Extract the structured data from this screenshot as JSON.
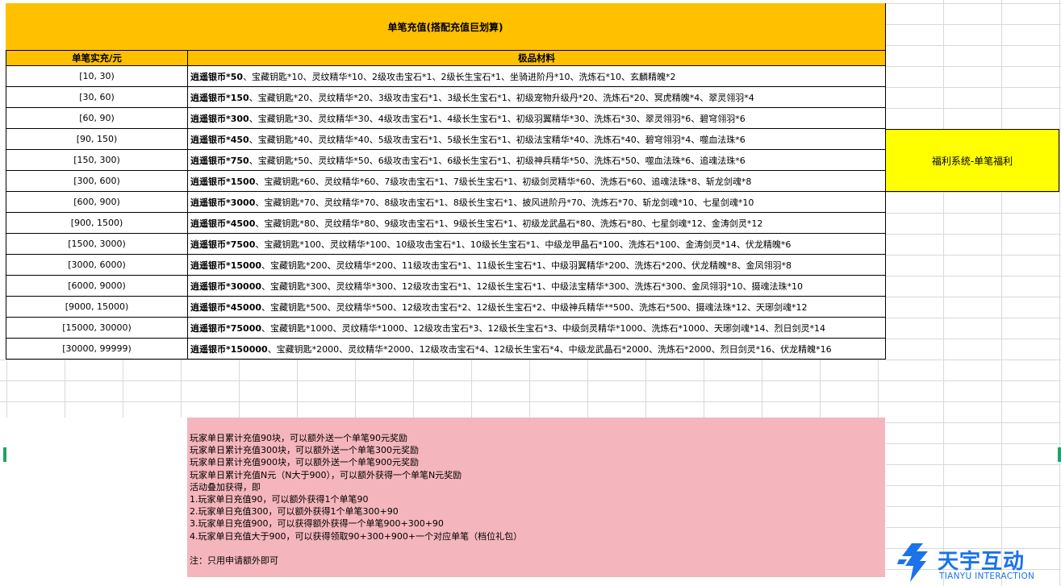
{
  "sheet": {
    "title": "单笔充值(搭配充值巨划算)",
    "headers": {
      "range": "单笔实充/元",
      "materials": "极品材料"
    },
    "rows": [
      {
        "range": "[10, 30)",
        "silver": "逍遥银币*50",
        "rest": "、宝藏钥匙*10、灵纹精华*10、2级攻击宝石*1、2级长生宝石*1、坐骑进阶丹*10、洗炼石*10、玄麟精魄*2"
      },
      {
        "range": "[30, 60)",
        "silver": "逍遥银币*150",
        "rest": "、宝藏钥匙*20、灵纹精华*20、3级攻击宝石*1、3级长生宝石*1、初级宠物升级丹*20、洗炼石*20、冥虎精魄*4、翠灵翎羽*4"
      },
      {
        "range": "[60, 90)",
        "silver": "逍遥银币*300",
        "rest": "、宝藏钥匙*30、灵纹精华*30、4级攻击宝石*1、4级长生宝石*1、初级羽翼精华*30、洗炼石*30、翠灵翎羽*6、碧穹翎羽*6"
      },
      {
        "range": "[90, 150)",
        "silver": "逍遥银币*450",
        "rest": "、宝藏钥匙*40、灵纹精华*40、5级攻击宝石*1、5级长生宝石*1、初级法宝精华*40、洗炼石*40、碧穹翎羽*4、噬血法珠*6"
      },
      {
        "range": "[150, 300)",
        "silver": "逍遥银币*750",
        "rest": "、宝藏钥匙*50、灵纹精华*50、6级攻击宝石*1、6级长生宝石*1、初级神兵精华*50、洗炼石*50、噬血法珠*6、追魂法珠*6"
      },
      {
        "range": "[300, 600)",
        "silver": "逍遥银币*1500",
        "rest": "、宝藏钥匙*60、灵纹精华*60、7级攻击宝石*1、7级长生宝石*1、初级剑灵精华*60、洗炼石*60、追魂法珠*8、斩龙剑魂*8"
      },
      {
        "range": "[600, 900)",
        "silver": "逍遥银币*3000",
        "rest": "、宝藏钥匙*70、灵纹精华*70、8级攻击宝石*1、8级长生宝石*1、披风进阶丹*70、洗炼石*70、斩龙剑魂*10、七星剑魂*10"
      },
      {
        "range": "[900, 1500)",
        "silver": "逍遥银币*4500",
        "rest": "、宝藏钥匙*80、灵纹精华*80、9级攻击宝石*1、9级长生宝石*1、初级龙武晶石*80、洗炼石*80、七星剑魂*12、金涛剑灵*12"
      },
      {
        "range": "[1500, 3000)",
        "silver": "逍遥银币*7500",
        "rest": "、宝藏钥匙*100、灵纹精华*100、10级攻击宝石*1、10级长生宝石*1、中级龙甲晶石*100、洗炼石*100、金涛剑灵*14、伏龙精魄*6"
      },
      {
        "range": "[3000, 6000)",
        "silver": "逍遥银币*15000",
        "rest": "、宝藏钥匙*200、灵纹精华*200、11级攻击宝石*1、11级长生宝石*1、中级羽翼精华*200、洗炼石*200、伏龙精魄*8、金凤翎羽*8"
      },
      {
        "range": "[6000, 9000)",
        "silver": "逍遥银币*30000",
        "rest": "、宝藏钥匙*300、灵纹精华*300、12级攻击宝石*1、12级长生宝石*1、中级法宝精华*300、洗炼石*300、金凤翎羽*10、摄魂法珠*10"
      },
      {
        "range": "[9000, 15000)",
        "silver": "逍遥银币*45000",
        "rest": "、宝藏钥匙*500、灵纹精华*500、12级攻击宝石*2、12级长生宝石*2、中级神兵精华**500、洗炼石*500、摄魂法珠*12、天琊剑魂*12"
      },
      {
        "range": "[15000, 30000)",
        "silver": "逍遥银币*75000",
        "rest": "、宝藏钥匙*1000、灵纹精华*1000、12级攻击宝石*3、12级长生宝石*3、中级剑灵精华*1000、洗炼石*1000、天琊剑魂*14、烈日剑灵*14"
      },
      {
        "range": "[30000, 99999)",
        "silver": "逍遥银币*150000",
        "rest": "、宝藏钥匙*2000、灵纹精华*2000、12级攻击宝石*4、12级长生宝石*4、中级龙武晶石*2000、洗炼石*2000、烈日剑灵*16、伏龙精魄*16"
      }
    ],
    "welfare_label": "福利系统-单笔福利",
    "note_lines": [
      "玩家单日累计充值90块，可以额外送一个单笔90元奖励",
      "玩家单日累计充值300块，可以额外送一个单笔300元奖励",
      "玩家单日累计充值900块，可以额外送一个单笔900元奖励",
      "玩家单日累计充值N元（N大于900），可以额外获得一个单笔N元奖励",
      "活动叠加获得，即",
      "1.玩家单日充值90，可以额外获得1个单笔90",
      "2.玩家单日充值300，可以额外获得1个单笔300+90",
      "3.玩家单日充值900，可以获得额外获得一个单笔900+300+90",
      "4.玩家单日充值大于900，可以获得领取90+300+900+一个对应单笔（档位礼包）",
      "",
      "注：只用申请额外即可"
    ],
    "colors": {
      "header_fill": "#ffc000",
      "welfare_fill": "#ffff00",
      "note_fill": "#f4b6bc",
      "logo_blue": "#1a73e8"
    }
  },
  "logo": {
    "name": "天宇互动",
    "sub": "TIANYU INTERACTION"
  }
}
